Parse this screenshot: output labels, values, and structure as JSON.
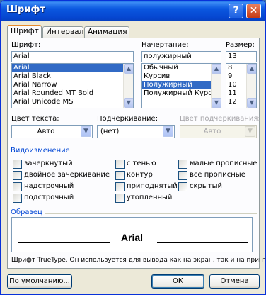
{
  "window": {
    "title": "Шрифт",
    "help_btn": "?",
    "close_btn": "✕"
  },
  "tabs": [
    {
      "label": "Шрифт",
      "active": true
    },
    {
      "label": "Интервал",
      "active": false
    },
    {
      "label": "Анимация",
      "active": false
    }
  ],
  "font": {
    "label": "Шрифт:",
    "value": "Arial",
    "items": [
      "Arial",
      "Arial Black",
      "Arial Narrow",
      "Arial Rounded MT Bold",
      "Arial Unicode MS"
    ],
    "selected_index": 0
  },
  "style": {
    "label": "Начертание:",
    "value": "полужирный",
    "items": [
      "Обычный",
      "Курсив",
      "Полужирный",
      "Полужирный Курсив"
    ],
    "selected_index": 2
  },
  "size": {
    "label": "Размер:",
    "value": "13",
    "items": [
      "8",
      "9",
      "10",
      "11",
      "12"
    ],
    "selected_index": -1
  },
  "text_color": {
    "label": "Цвет текста:",
    "value": "Авто"
  },
  "underline": {
    "label": "Подчеркивание:",
    "value": "(нет)"
  },
  "underline_color": {
    "label": "Цвет подчеркивания:",
    "value": "Авто"
  },
  "effects": {
    "title": "Видоизменение",
    "col1": [
      "зачеркнутый",
      "двойное зачеркивание",
      "надстрочный",
      "подстрочный"
    ],
    "col2": [
      "с тенью",
      "контур",
      "приподнятый",
      "утопленный"
    ],
    "col3": [
      "малые прописные",
      "все прописные",
      "скрытый"
    ]
  },
  "sample": {
    "title": "Образец",
    "text": "Arial"
  },
  "note": "Шрифт TrueType. Он используется для вывода как на экран, так и на принтер.",
  "buttons": {
    "default": "По умолчанию...",
    "ok": "ОК",
    "cancel": "Отмена"
  },
  "colors": {
    "title_bar": "#0545cf",
    "selection": "#316ac5",
    "group_title": "#0046d5"
  }
}
